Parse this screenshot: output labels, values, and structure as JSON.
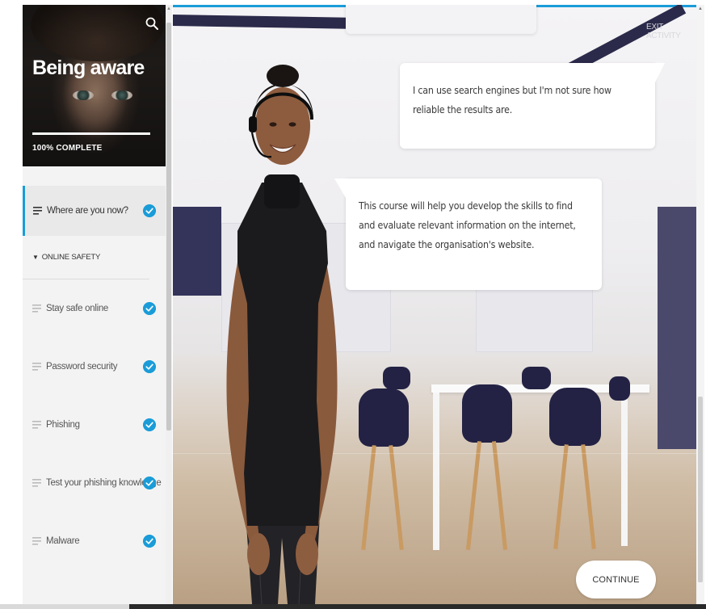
{
  "sidebar": {
    "course_title": "Being aware",
    "progress_label": "100% COMPLETE",
    "progress_fraction": 1.0,
    "current_item": {
      "label": "Where are you now?",
      "completed": true
    },
    "section": {
      "label": "ONLINE SAFETY",
      "expanded": true
    },
    "items": [
      {
        "label": "Stay safe online",
        "completed": true
      },
      {
        "label": "Password security",
        "completed": true
      },
      {
        "label": "Phishing",
        "completed": true
      },
      {
        "label": "Test your phishing knowledge",
        "completed": true
      },
      {
        "label": "Malware",
        "completed": true
      }
    ]
  },
  "main": {
    "exit_label": "EXIT ACTIVITY",
    "bubble_1": "I can use search engines but I'm not sure how reliable the results are.",
    "bubble_2": "This course will help you develop the skills to find and evaluate relevant information on the internet, and navigate the organisation's website.",
    "continue_label": "CONTINUE"
  },
  "colors": {
    "accent": "#1a9cd8",
    "sidebar_bg": "#f3f3f3",
    "scene_dark": "#2b2a4a"
  },
  "icons": {
    "search": "search-icon",
    "menu_lines": "lines-icon",
    "check": "check-circle-icon",
    "section_toggle": "triangle-down-icon"
  }
}
